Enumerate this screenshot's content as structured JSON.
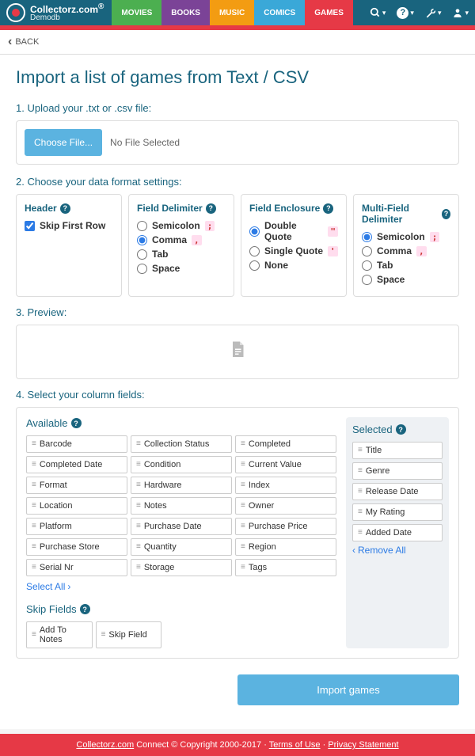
{
  "header": {
    "brand": "Collectorz.com",
    "brand_sup": "®",
    "subtitle": "Demodb",
    "tabs": [
      "MOVIES",
      "BOOKS",
      "MUSIC",
      "COMICS",
      "GAMES"
    ]
  },
  "back": {
    "label": "BACK"
  },
  "page": {
    "title": "Import a list of games from Text / CSV",
    "step1": "1. Upload your .txt or .csv file:",
    "choose_btn": "Choose File...",
    "no_file": "No File Selected",
    "step2": "2. Choose your data format settings:",
    "step3": "3. Preview:",
    "step4": "4. Select your column fields:"
  },
  "format": {
    "header": {
      "title": "Header",
      "skip": "Skip First Row",
      "skip_checked": true
    },
    "field_delim": {
      "title": "Field Delimiter",
      "options": [
        "Semicolon",
        "Comma",
        "Tab",
        "Space"
      ],
      "chips": [
        ";",
        ",",
        "",
        ""
      ],
      "selected": "Comma"
    },
    "field_enc": {
      "title": "Field Enclosure",
      "options": [
        "Double Quote",
        "Single Quote",
        "None"
      ],
      "chips": [
        "\"",
        "'",
        ""
      ],
      "selected": "Double Quote"
    },
    "multi_delim": {
      "title": "Multi-Field Delimiter",
      "options": [
        "Semicolon",
        "Comma",
        "Tab",
        "Space"
      ],
      "chips": [
        ";",
        ",",
        "",
        ""
      ],
      "selected": "Semicolon"
    }
  },
  "columns": {
    "available_title": "Available",
    "selected_title": "Selected",
    "available": [
      "Barcode",
      "Collection Status",
      "Completed",
      "Completed Date",
      "Condition",
      "Current Value",
      "Format",
      "Hardware",
      "Index",
      "Location",
      "Notes",
      "Owner",
      "Platform",
      "Purchase Date",
      "Purchase Price",
      "Purchase Store",
      "Quantity",
      "Region",
      "Serial Nr",
      "Storage",
      "Tags"
    ],
    "selected": [
      "Title",
      "Genre",
      "Release Date",
      "My Rating",
      "Added Date"
    ],
    "select_all": "Select All",
    "remove_all": "Remove All",
    "skip_title": "Skip Fields",
    "skip": [
      "Add To Notes",
      "Skip Field"
    ]
  },
  "import_btn": "Import games",
  "footer": {
    "brand": "Collectorz.com",
    "text": " Connect © Copyright 2000-2017 · ",
    "terms": "Terms of Use",
    "privacy": "Privacy Statement"
  }
}
